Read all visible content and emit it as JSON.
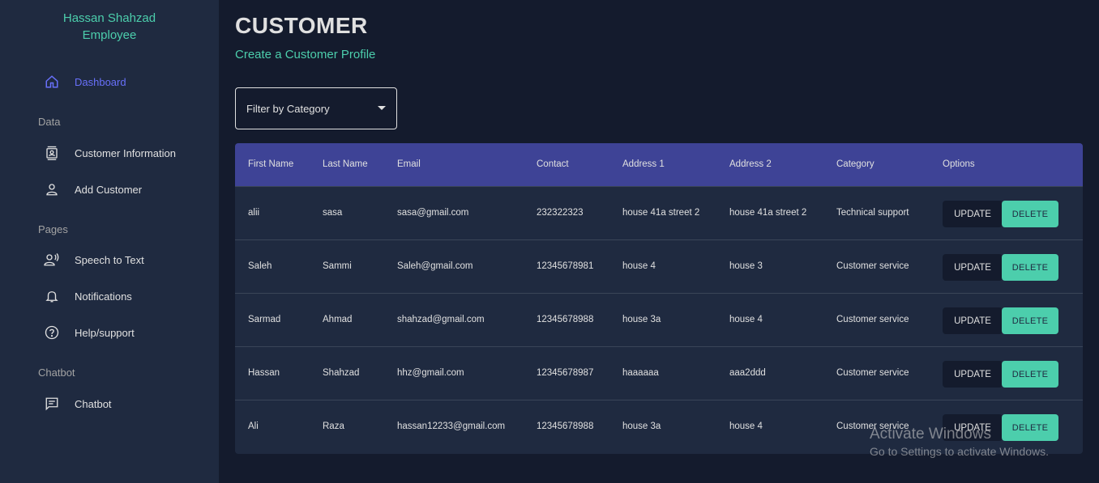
{
  "sidebar": {
    "user_name": "Hassan Shahzad",
    "user_role": "Employee",
    "dashboard": "Dashboard",
    "section_data": "Data",
    "customer_information": "Customer Information",
    "add_customer": "Add Customer",
    "section_pages": "Pages",
    "speech_to_text": "Speech to Text",
    "notifications": "Notifications",
    "help_support": "Help/support",
    "section_chatbot": "Chatbot",
    "chatbot": "Chatbot"
  },
  "header": {
    "title": "CUSTOMER",
    "subtitle": "Create a Customer Profile"
  },
  "filter": {
    "label": "Filter by Category"
  },
  "table": {
    "columns": [
      "First Name",
      "Last Name",
      "Email",
      "Contact",
      "Address 1",
      "Address 2",
      "Category",
      "Options"
    ],
    "update_label": "UPDATE",
    "delete_label": "DELETE",
    "rows": [
      [
        "alii",
        "sasa",
        "sasa@gmail.com",
        "232322323",
        "house 41a street 2",
        "house 41a street 2",
        "Technical support"
      ],
      [
        "Saleh",
        "Sammi",
        "Saleh@gmail.com",
        "12345678981",
        "house 4",
        "house 3",
        "Customer service"
      ],
      [
        "Sarmad",
        "Ahmad",
        "shahzad@gmail.com",
        "12345678988",
        "house 3a",
        "house 4",
        "Customer service"
      ],
      [
        "Hassan",
        "Shahzad",
        "hhz@gmail.com",
        "12345678987",
        "haaaaaa",
        "aaa2ddd",
        "Customer service"
      ],
      [
        "Ali",
        "Raza",
        "hassan12233@gmail.com",
        "12345678988",
        "house 3a",
        "house 4",
        "Customer service"
      ]
    ]
  },
  "watermark": {
    "line1": "Activate Windows",
    "line2": "Go to Settings to activate Windows."
  },
  "colors": {
    "accent": "#4cceac",
    "active_nav": "#6870fa",
    "table_header": "#3e4396",
    "sidebar_bg": "#1f2a40",
    "page_bg": "#141b2d"
  }
}
